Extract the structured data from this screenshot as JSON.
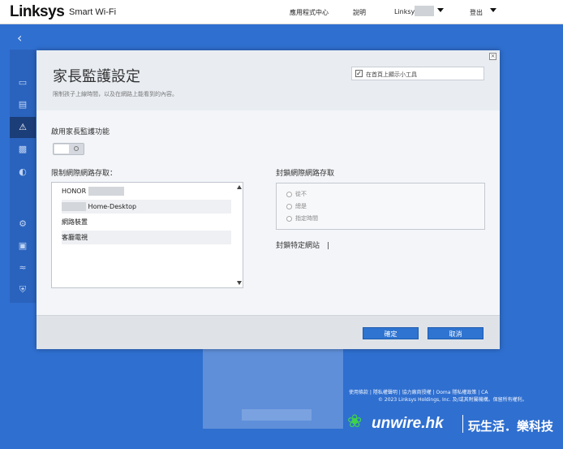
{
  "topbar": {
    "logo": "Linksys",
    "product": "Smart Wi-Fi",
    "nav": {
      "app_center": "應用程式中心",
      "help": "說明",
      "user": "Linksys",
      "logout": "登出"
    }
  },
  "modal": {
    "title": "家長監護設定",
    "subtitle": "限制孩子上線時間，以及在網路上能看到的內容。",
    "close": "×",
    "show_widget_label": "在首頁上顯示小工具",
    "show_widget_checked": true,
    "enable_label": "啟用家長監護功能",
    "restrict_label": "限制網際網路存取：",
    "devices": [
      {
        "name": "HONOR"
      },
      {
        "name": "Home-Desktop"
      },
      {
        "name": "網路裝置"
      },
      {
        "name": "客廳電視"
      }
    ],
    "block_access_label": "封鎖網際網路存取",
    "block_options": [
      "從不",
      "總是",
      "指定時間"
    ],
    "block_sites_label": "封鎖特定網站",
    "ok_button": "確定",
    "cancel_button": "取消"
  },
  "footer": {
    "links": "使用條款 | 隱私權聲明 | 協力廠商授權 | Ooma 隱私權政策 | CA",
    "copyright": "© 2023 Linksys Holdings, Inc. 及/或其附屬機構。保留所有權利。"
  },
  "watermark": {
    "brand": "unwire.hk",
    "slogan": "玩生活．樂科技"
  },
  "colors": {
    "background": "#2f6fd0",
    "primary_button": "#2f74d0",
    "sidebar_active": "#1b3d78"
  }
}
